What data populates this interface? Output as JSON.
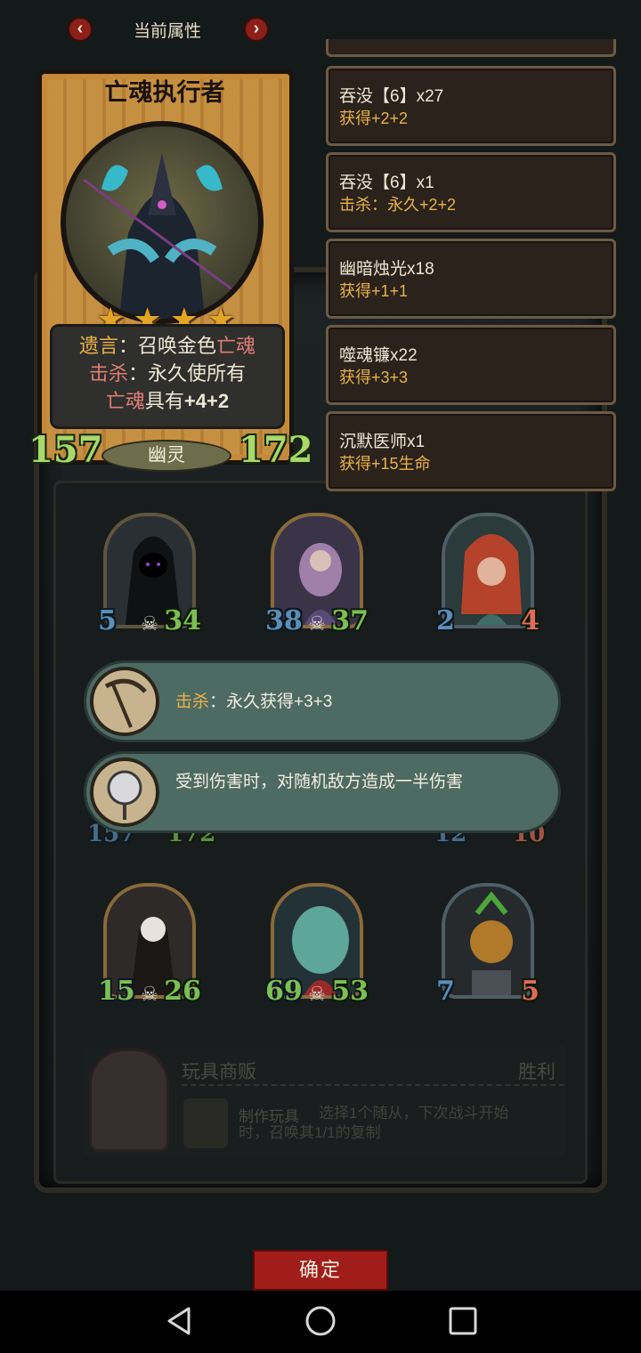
{
  "header": {
    "title": "当前属性",
    "prev_icon": "chevron-left-icon",
    "next_icon": "chevron-right-icon",
    "prev_glyph": "‹",
    "next_glyph": "›"
  },
  "card": {
    "name": "亡魂执行者",
    "stars": 4,
    "star_glyph": "★",
    "desc": {
      "deathrattle_label": "遗言",
      "deathrattle_text_1": "：召唤金色",
      "deathrattle_keyword": "亡魂",
      "kill_label": "击杀",
      "kill_text_1": "：永久使所有",
      "kill_keyword": "亡魂",
      "kill_text_2": "具有",
      "kill_bonus": "+4+2"
    },
    "attack": "157",
    "health": "172",
    "tribe": "幽灵"
  },
  "buffs": [
    {
      "name": "吞没【6】x27",
      "effect": "获得+2+2"
    },
    {
      "name": "吞没【6】x1",
      "effect": "击杀：永久+2+2"
    },
    {
      "name": "幽暗烛光x18",
      "effect": "获得+1+1"
    },
    {
      "name": "噬魂镰x22",
      "effect": "获得+3+3"
    },
    {
      "name": "沉默医师x1",
      "effect": "获得+15生命"
    }
  ],
  "minions_row1": [
    {
      "atk": "5",
      "hp": "34"
    },
    {
      "atk": "38",
      "hp": "37"
    },
    {
      "atk": "2",
      "hp": "4"
    }
  ],
  "minions_row2_partial": {
    "left_atk": "157",
    "left_hp": "172",
    "right_atk": "12",
    "right_hp": "10"
  },
  "minions_row3": [
    {
      "atk": "15",
      "hp": "26"
    },
    {
      "atk": "69",
      "hp": "53"
    },
    {
      "atk": "7",
      "hp": "5"
    }
  ],
  "skull_glyph": "☠",
  "tips": [
    {
      "label": "击杀",
      "text": "：永久获得+3+3",
      "icon": "scythe-icon"
    },
    {
      "label": "",
      "text": "受到伤害时，对随机敌方造成一半伤害",
      "icon": "mirror-icon"
    }
  ],
  "shop": {
    "title": "玩具商贩",
    "result": "胜利",
    "skill_name": "制作玩具",
    "skill_desc": "选择1个随从，下次战斗开始时，召唤其1/1的复制"
  },
  "confirm_label": "确定",
  "navbar": {
    "back_icon": "back-triangle-icon",
    "home_icon": "home-circle-icon",
    "recent_icon": "recent-square-icon"
  },
  "colors": {
    "accent_red": "#a11d1a",
    "gold": "#e9b34a",
    "green_stat": "#a9d86b",
    "blue_stat": "#5b8fb8"
  }
}
